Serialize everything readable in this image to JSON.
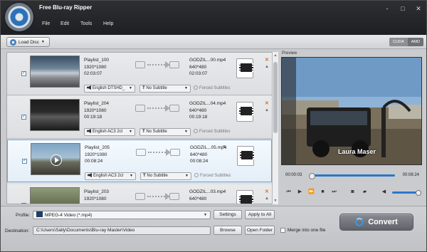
{
  "app": {
    "title": "Free Blu-ray Ripper"
  },
  "menu": [
    "File",
    "Edit",
    "Tools",
    "Help"
  ],
  "window_controls": [
    "-",
    "□",
    "✕"
  ],
  "toolbar": {
    "load_disc": "Load Disc",
    "cuda": "CUDA",
    "amd": "AMD"
  },
  "rows": [
    {
      "name": "Playlist_100",
      "res": "1920*1080",
      "dur": "02:03:07",
      "out_name": "GODZIL...00.mp4",
      "out_res": "640*480",
      "out_dur": "02:03:07",
      "audio": "English DTSHD_",
      "subtitle": "No Subtitle",
      "forced": "Forced Subtitles",
      "checked": true,
      "selected": false
    },
    {
      "name": "Playlist_204",
      "res": "1920*1080",
      "dur": "00:19:18",
      "out_name": "GODZIL...04.mp4",
      "out_res": "640*480",
      "out_dur": "00:19:18",
      "audio": "English AC3 2cl",
      "subtitle": "No Subtitle",
      "forced": "Forced Subtitles",
      "checked": true,
      "selected": false
    },
    {
      "name": "Playlist_205",
      "res": "1920*1080",
      "dur": "00:08:24",
      "out_name": "GODZIL...05.mp4",
      "out_res": "640*480",
      "out_dur": "00:08:24",
      "audio": "English AC3 2cl",
      "subtitle": "No Subtitle",
      "forced": "Forced Subtitles",
      "checked": true,
      "selected": true
    },
    {
      "name": "Playlist_203",
      "res": "1920*1080",
      "dur": "",
      "out_name": "GODZIL...03.mp4",
      "out_res": "640*480",
      "out_dur": "",
      "audio": "",
      "subtitle": "",
      "forced": "",
      "checked": true,
      "selected": false
    }
  ],
  "preview": {
    "label": "Preview",
    "time_current": "00:00:03",
    "time_total": "00:08:24",
    "watermark": "Laura Maser"
  },
  "bottom": {
    "profile_label": "Profile:",
    "profile_value": "MPEG-4 Video (*.mp4)",
    "settings": "Settings",
    "apply_all": "Apply to All",
    "destination_label": "Destination:",
    "destination_value": "C:\\Users\\Sally\\Documents\\Blu-ray Master\\Video",
    "browse": "Browse",
    "open_folder": "Open Folder",
    "merge": "Merge into one file",
    "convert": "Convert"
  }
}
